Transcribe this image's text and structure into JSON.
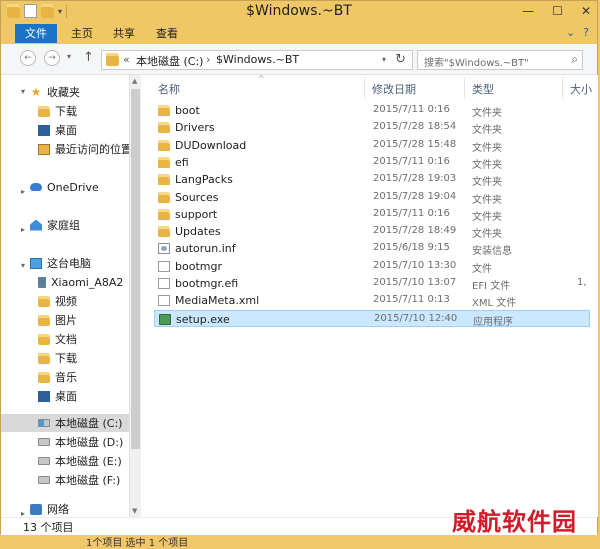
{
  "window": {
    "title": "$Windows.~BT",
    "minimize": "—",
    "maximize": "☐",
    "close": "✕"
  },
  "ribbon": {
    "tabs": [
      "文件",
      "主页",
      "共享",
      "查看"
    ],
    "expand_glyph": "⌄",
    "help_glyph": "?"
  },
  "addressbar": {
    "back": "←",
    "forward": "→",
    "recent": "▾",
    "up": "↑",
    "overflow": "«",
    "crumbs": [
      "本地磁盘 (C:)",
      "$Windows.~BT"
    ],
    "separator": "›",
    "dropdown": "▾",
    "refresh": "↻",
    "search_placeholder": "搜索\"$Windows.~BT\"",
    "search_icon": "⌕"
  },
  "navpane": {
    "favorites": {
      "label": "收藏夹",
      "items": [
        "下载",
        "桌面",
        "最近访问的位置"
      ]
    },
    "onedrive": "OneDrive",
    "homegroup": "家庭组",
    "thispc": {
      "label": "这台电脑",
      "items": [
        "Xiaomi_A8A2",
        "视频",
        "图片",
        "文档",
        "下载",
        "音乐",
        "桌面",
        "本地磁盘 (C:)",
        "本地磁盘 (D:)",
        "本地磁盘 (E:)",
        "本地磁盘 (F:)"
      ]
    },
    "network": "网络",
    "selected": "本地磁盘 (C:)"
  },
  "columns": {
    "name": "名称",
    "date": "修改日期",
    "type": "类型",
    "size": "大小"
  },
  "files": [
    {
      "name": "boot",
      "date": "2015/7/11 0:16",
      "type": "文件夹",
      "size": "",
      "icon": "folder"
    },
    {
      "name": "Drivers",
      "date": "2015/7/28 18:54",
      "type": "文件夹",
      "size": "",
      "icon": "folder"
    },
    {
      "name": "DUDownload",
      "date": "2015/7/28 15:48",
      "type": "文件夹",
      "size": "",
      "icon": "folder"
    },
    {
      "name": "efi",
      "date": "2015/7/11 0:16",
      "type": "文件夹",
      "size": "",
      "icon": "folder"
    },
    {
      "name": "LangPacks",
      "date": "2015/7/28 19:03",
      "type": "文件夹",
      "size": "",
      "icon": "folder"
    },
    {
      "name": "Sources",
      "date": "2015/7/28 19:04",
      "type": "文件夹",
      "size": "",
      "icon": "folder"
    },
    {
      "name": "support",
      "date": "2015/7/11 0:16",
      "type": "文件夹",
      "size": "",
      "icon": "folder"
    },
    {
      "name": "Updates",
      "date": "2015/7/28 18:49",
      "type": "文件夹",
      "size": "",
      "icon": "folder"
    },
    {
      "name": "autorun.inf",
      "date": "2015/6/18 9:15",
      "type": "安装信息",
      "size": "",
      "icon": "inf"
    },
    {
      "name": "bootmgr",
      "date": "2015/7/10 13:30",
      "type": "文件",
      "size": "",
      "icon": "file"
    },
    {
      "name": "bootmgr.efi",
      "date": "2015/7/10 13:07",
      "type": "EFI 文件",
      "size": "1,",
      "icon": "file"
    },
    {
      "name": "MediaMeta.xml",
      "date": "2015/7/11 0:13",
      "type": "XML 文件",
      "size": "",
      "icon": "file"
    },
    {
      "name": "setup.exe",
      "date": "2015/7/10 12:40",
      "type": "应用程序",
      "size": "",
      "icon": "exe"
    }
  ],
  "selected_file": "setup.exe",
  "statusbar": {
    "count": "13 个项目"
  },
  "watermark": "威航软件园",
  "underneath": "1个项目    选中 1 个项目",
  "colors": {
    "titlebar": "#f0c765",
    "file_tab": "#1a73c7",
    "selection": "#cce8ff",
    "watermark": "#d21a2a"
  }
}
